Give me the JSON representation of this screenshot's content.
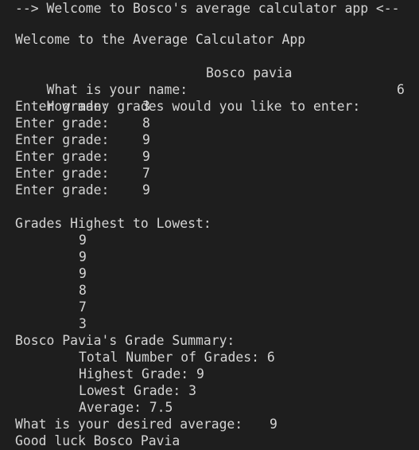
{
  "banner": "--> Welcome to Bosco's average calculator app <--",
  "welcome": "Welcome to the Average Calculator App",
  "name_prompt": "What is your name:",
  "name_value": "Bosco pavia",
  "count_prompt": "How many grades would you like to enter:",
  "count_value": "6",
  "grade_prompt": "Enter grade:",
  "grades_entered": [
    "3",
    "8",
    "9",
    "9",
    "7",
    "9"
  ],
  "sorted_header": "Grades Highest to Lowest:",
  "grades_sorted": [
    "9",
    "9",
    "9",
    "8",
    "7",
    "3"
  ],
  "summary_header": "Bosco Pavia's Grade Summary:",
  "summary": {
    "total": "Total Number of Grades: 6",
    "highest": "Highest Grade: 9",
    "lowest": "Lowest Grade: 3",
    "average": "Average: 7.5"
  },
  "desired_prompt": "What is your desired average:",
  "desired_value": "9",
  "goodbye": "Good luck Bosco Pavia"
}
